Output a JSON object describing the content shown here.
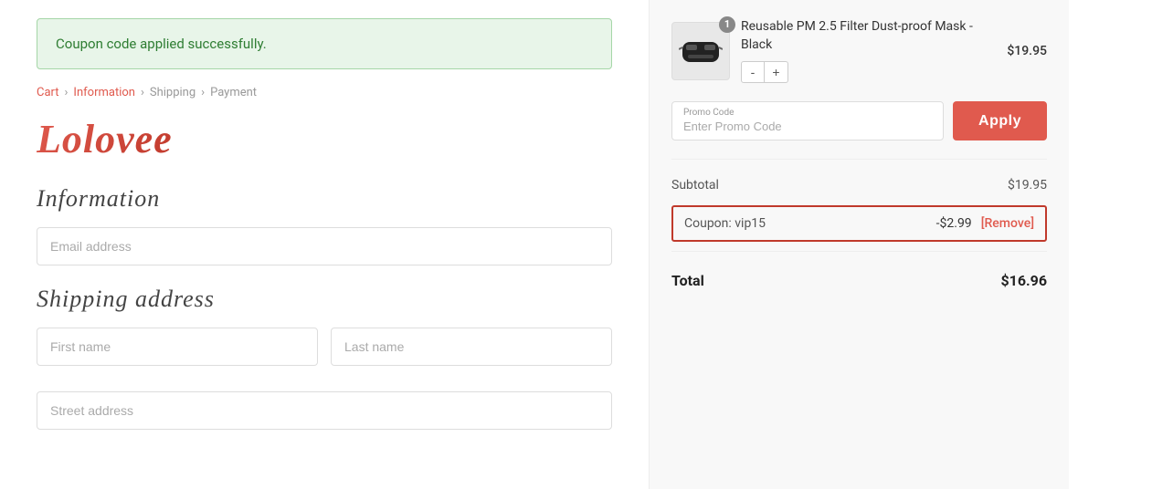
{
  "success_banner": {
    "message": "Coupon code applied successfully."
  },
  "breadcrumb": {
    "cart": "Cart",
    "information": "Information",
    "shipping": "Shipping",
    "payment": "Payment",
    "separator": "›"
  },
  "logo": {
    "text": "Lolovee"
  },
  "information_section": {
    "title": "Information",
    "email_placeholder": "Email address"
  },
  "shipping_section": {
    "title": "Shipping address",
    "first_name_placeholder": "First name",
    "last_name_placeholder": "Last name",
    "street_placeholder": "Street address"
  },
  "product": {
    "name": "Reusable PM 2.5 Filter Dust-proof Mask - Black",
    "price": "$19.95",
    "quantity_badge": "1",
    "quantity_minus": "-",
    "quantity_plus": "+"
  },
  "promo": {
    "label": "Promo Code",
    "placeholder": "Enter Promo Code",
    "apply_label": "Apply"
  },
  "order_summary": {
    "subtotal_label": "Subtotal",
    "subtotal_value": "$19.95",
    "coupon_label": "Coupon: vip15",
    "coupon_discount": "-$2.99",
    "coupon_remove": "[Remove]",
    "total_label": "Total",
    "total_value": "$16.96"
  }
}
